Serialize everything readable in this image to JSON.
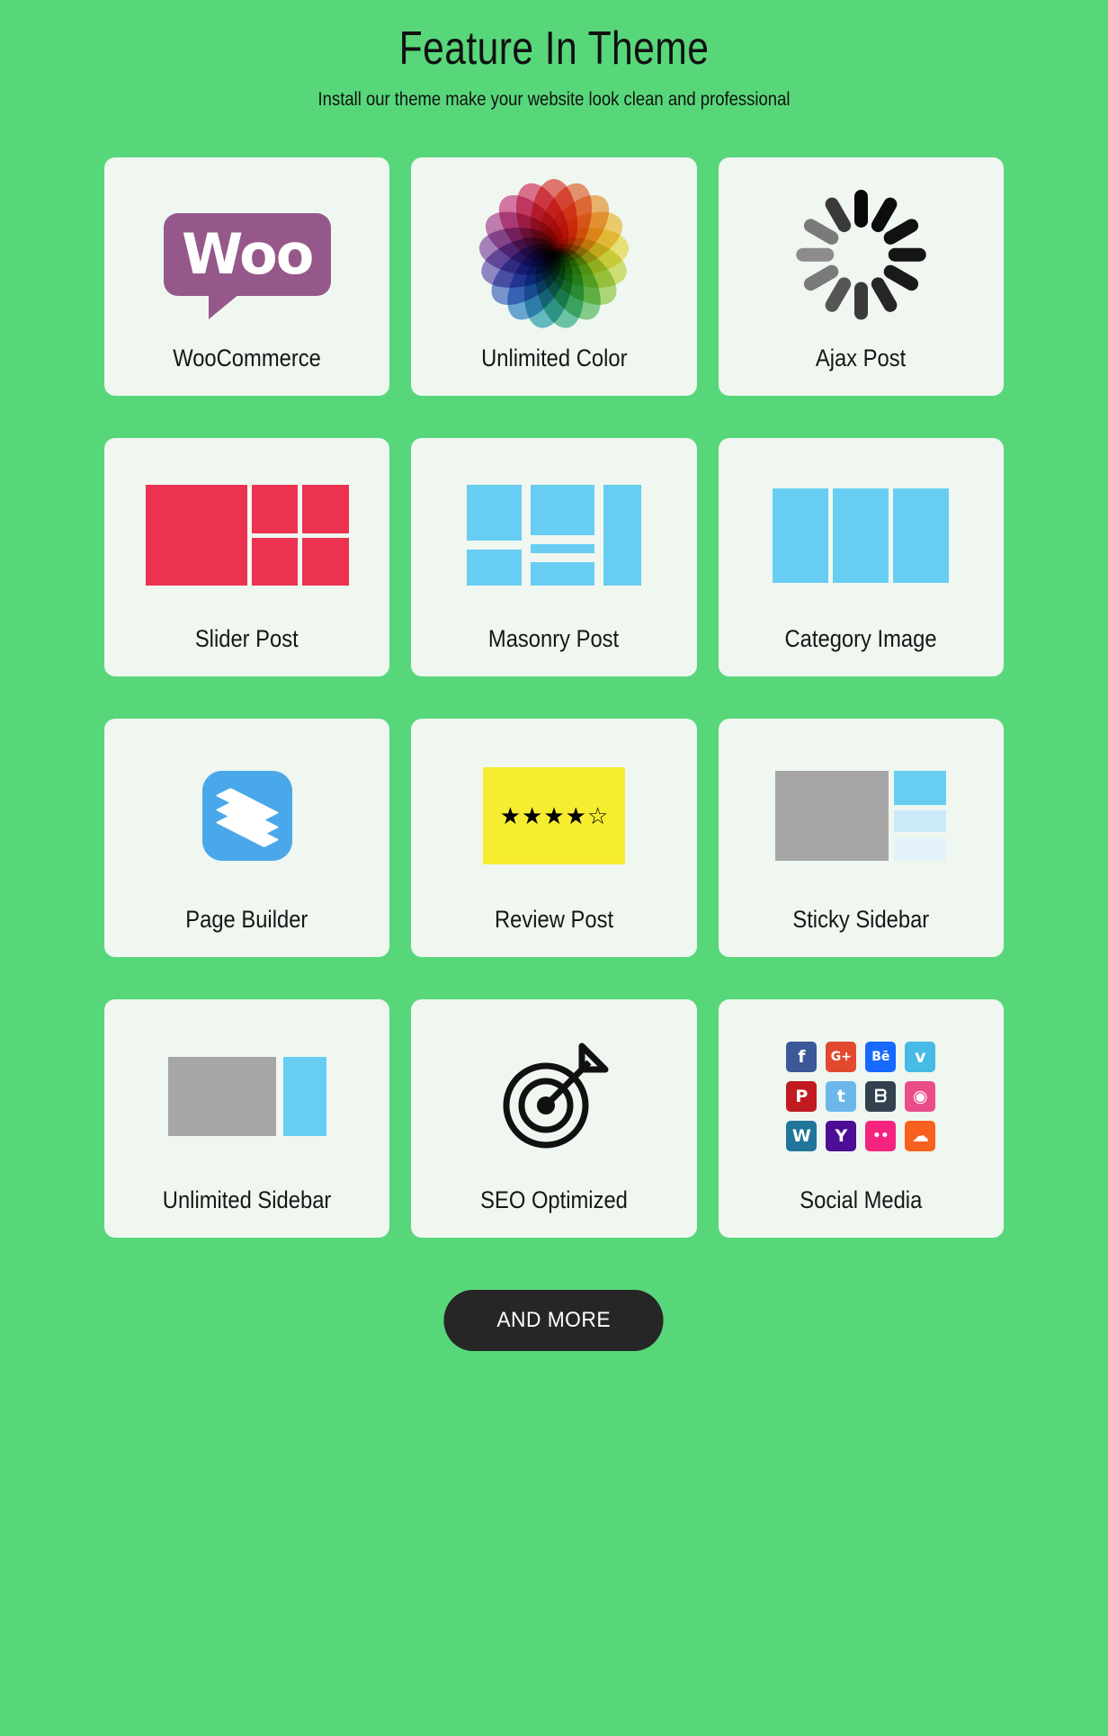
{
  "header": {
    "title": "Feature In Theme",
    "subtitle": "Install our theme make your website look clean and professional"
  },
  "theme": {
    "background": "#58d77a",
    "card_background": "#eff7f0",
    "text": "#161616",
    "button_background": "#262626",
    "accent_red": "#ec3250",
    "accent_blue": "#68cdf2",
    "accent_yellow": "#f7ed30",
    "accent_purple": "#96588a",
    "accent_gray": "#a6a6a6"
  },
  "cards": [
    {
      "label": "WooCommerce",
      "icon": "woocommerce-logo-icon",
      "logo_text": "Woo"
    },
    {
      "label": "Unlimited Color",
      "icon": "color-wheel-icon"
    },
    {
      "label": "Ajax Post",
      "icon": "loading-spinner-icon"
    },
    {
      "label": "Slider Post",
      "icon": "slider-layout-icon"
    },
    {
      "label": "Masonry Post",
      "icon": "masonry-layout-icon"
    },
    {
      "label": "Category Image",
      "icon": "category-columns-icon"
    },
    {
      "label": "Page Builder",
      "icon": "layers-stack-icon"
    },
    {
      "label": "Review Post",
      "icon": "star-rating-icon",
      "rating": 4,
      "max_rating": 5
    },
    {
      "label": "Sticky Sidebar",
      "icon": "sticky-sidebar-layout-icon"
    },
    {
      "label": "Unlimited Sidebar",
      "icon": "unlimited-sidebar-layout-icon"
    },
    {
      "label": "SEO Optimized",
      "icon": "target-dart-icon"
    },
    {
      "label": "Social Media",
      "icon": "social-icons-grid-icon"
    }
  ],
  "color_wheel": {
    "petals": [
      "#e8453c",
      "#ef6c3e",
      "#f59a3e",
      "#f7c140",
      "#f4e04a",
      "#cfdc47",
      "#9ccf4d",
      "#5ec16a",
      "#3bb68f",
      "#31a8b8",
      "#3a8ad4",
      "#4f6ec9",
      "#6f5dbe",
      "#9055b2",
      "#b94f9f",
      "#d4458a",
      "#e0406a"
    ]
  },
  "spinner": {
    "spokes": 12,
    "colors": [
      "#080808",
      "#0d0d0d",
      "#111111",
      "#151515",
      "#1a1a1a",
      "#262626",
      "#3a3a3a",
      "#555555",
      "#7a7a7a",
      "#8c8c8c",
      "#7a7a7a",
      "#3a3a3a"
    ]
  },
  "social_icons": [
    {
      "name": "facebook",
      "glyph": "f",
      "color": "#3b5998"
    },
    {
      "name": "google-plus",
      "glyph": "G+",
      "color": "#e2492f"
    },
    {
      "name": "behance",
      "glyph": "Bē",
      "color": "#1769ff"
    },
    {
      "name": "vimeo",
      "glyph": "v",
      "color": "#45bbe6"
    },
    {
      "name": "pinterest",
      "glyph": "P",
      "color": "#c21a21"
    },
    {
      "name": "twitter",
      "glyph": "t",
      "color": "#6cb7ea"
    },
    {
      "name": "deviantart",
      "glyph": "ᗷ",
      "color": "#33414f"
    },
    {
      "name": "dribbble",
      "glyph": "◉",
      "color": "#ea4c89"
    },
    {
      "name": "wordpress",
      "glyph": "W",
      "color": "#21759b"
    },
    {
      "name": "yahoo",
      "glyph": "Y",
      "color": "#4b0e95"
    },
    {
      "name": "flickr",
      "glyph": "••",
      "color": "#f5257f"
    },
    {
      "name": "soundcloud",
      "glyph": "☁",
      "color": "#f8601f"
    }
  ],
  "footer": {
    "more_button": "AND MORE"
  }
}
